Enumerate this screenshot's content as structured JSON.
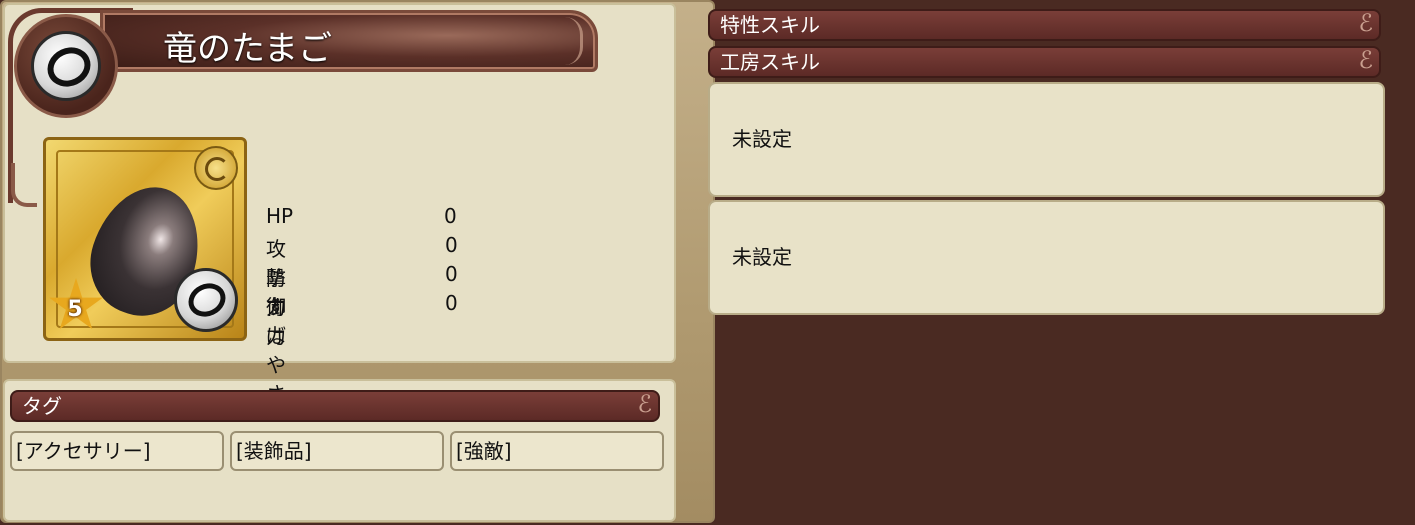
{
  "item": {
    "name": "竜のたまご",
    "rarity": "5"
  },
  "stats": [
    {
      "label": "HP",
      "value": "0"
    },
    {
      "label": "攻撃力",
      "value": "0"
    },
    {
      "label": "防御力",
      "value": "0"
    },
    {
      "label": "すばやさ",
      "value": "0"
    }
  ],
  "tags": {
    "header": "タグ",
    "items": [
      "[アクセサリー]",
      "[装飾品]",
      "[強敵]"
    ]
  },
  "skills": {
    "trait_header": "特性スキル",
    "workshop_header": "工房スキル",
    "slots": [
      "未設定",
      "未設定"
    ]
  },
  "icons": {
    "category": "ring-icon",
    "card_category": "ring-icon",
    "card_corner": "swirl-icon",
    "rarity": "star-icon"
  },
  "colors": {
    "panel": "#e6e0c6",
    "banner": "#5c2a26",
    "background": "#4a2a22",
    "card_gold": "#d9a92e"
  }
}
